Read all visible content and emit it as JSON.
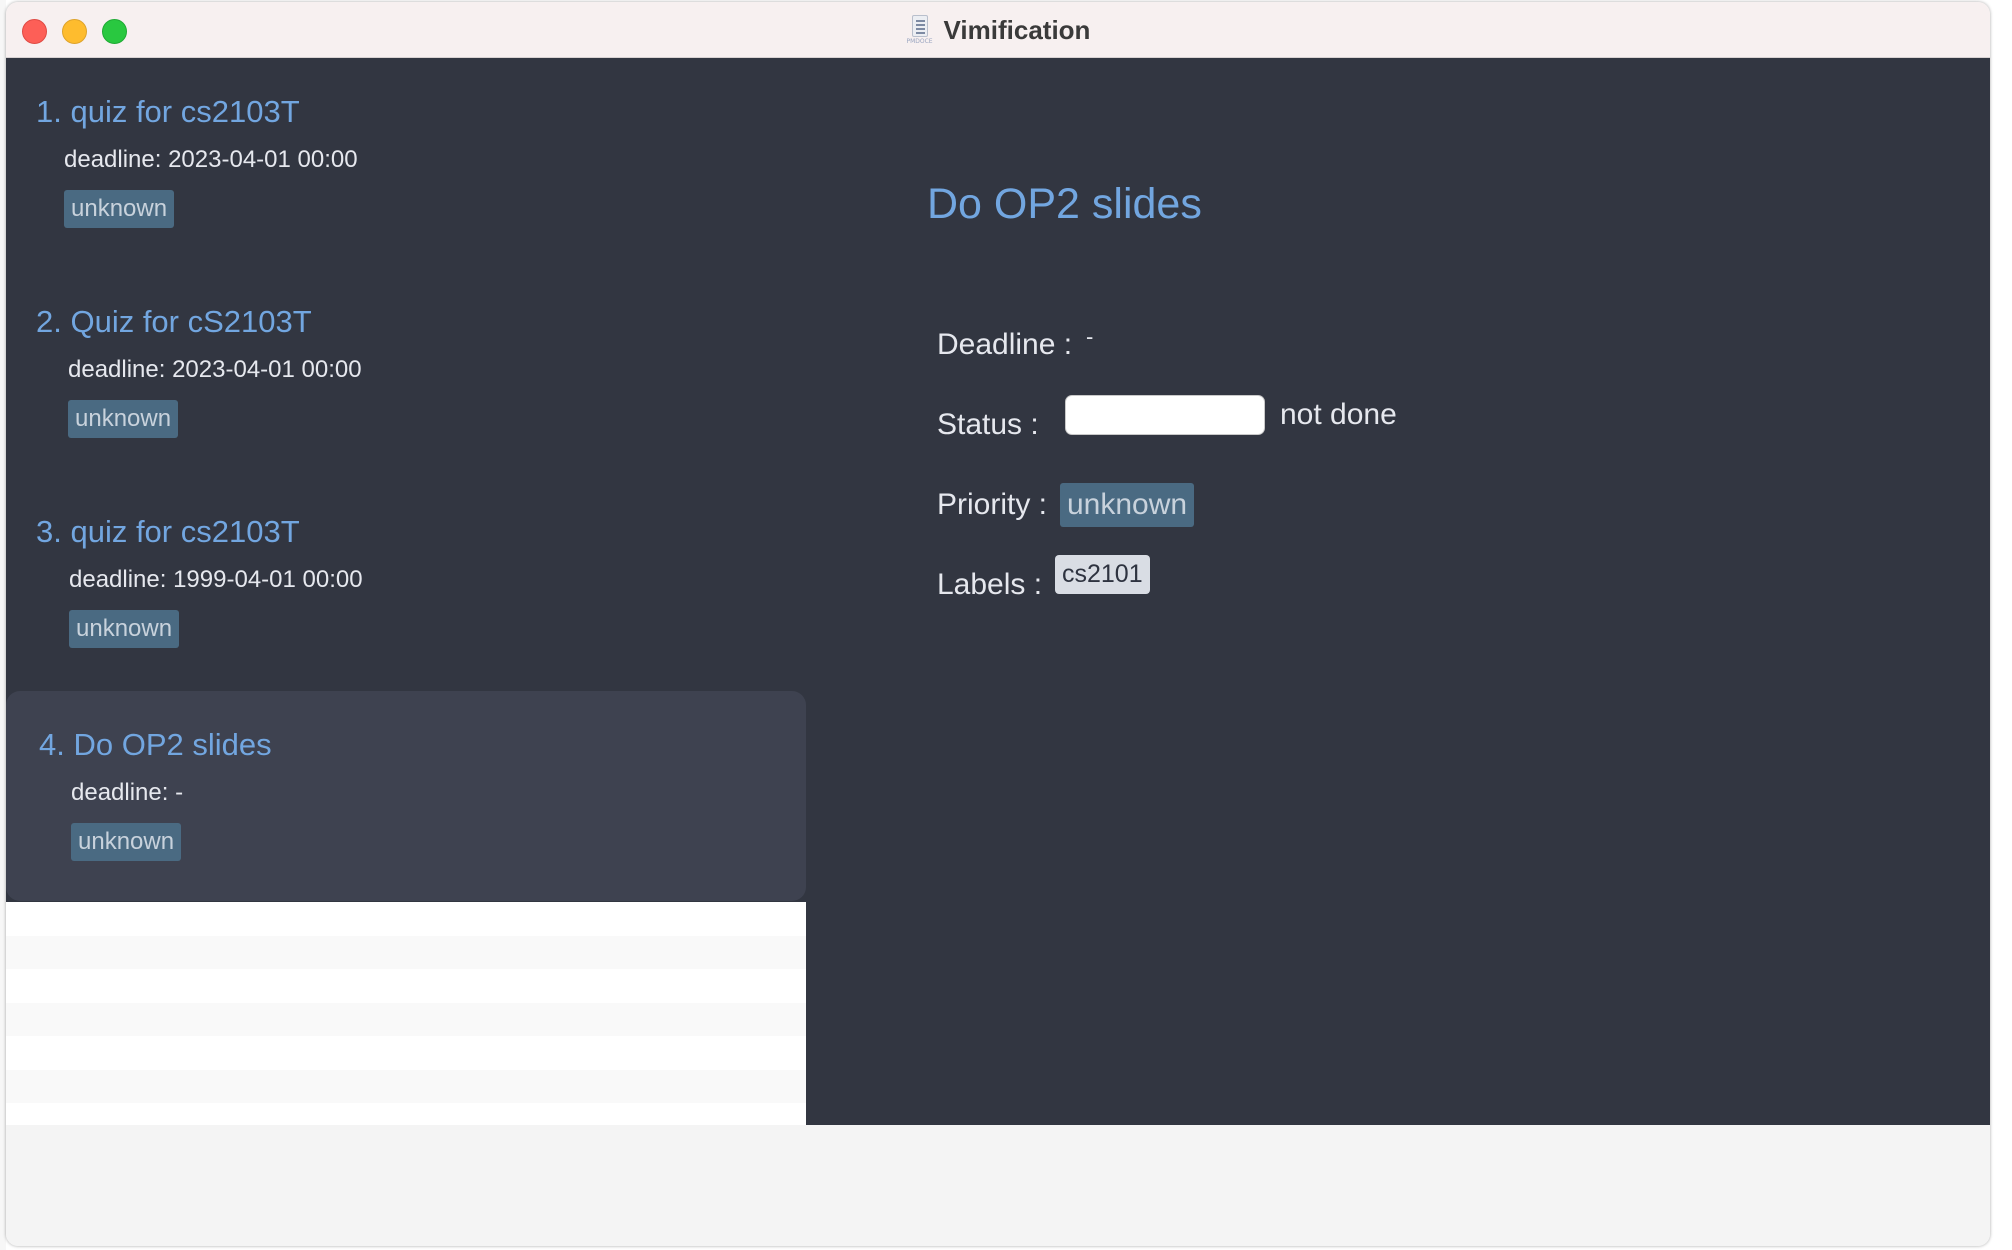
{
  "window": {
    "title": "Vimification",
    "icon": "document-icon",
    "icon_caption": "PMDOCE"
  },
  "task_list": [
    {
      "title": "1. quiz for cs2103T",
      "deadline": "deadline: 2023-04-01 00:00",
      "priority": "unknown",
      "selected": false
    },
    {
      "title": "2. Quiz for cS2103T",
      "deadline": "deadline: 2023-04-01 00:00",
      "priority": "unknown",
      "selected": false
    },
    {
      "title": "3. quiz for cs2103T",
      "deadline": "deadline: 1999-04-01 00:00",
      "priority": "unknown",
      "selected": false
    },
    {
      "title": "4. Do OP2 slides",
      "deadline": "deadline: -",
      "priority": "unknown",
      "selected": true
    }
  ],
  "detail": {
    "title": "Do OP2 slides",
    "deadline_label": "Deadline :",
    "deadline_value": "-",
    "status_label": "Status :",
    "status_value": "not done",
    "priority_label": "Priority :",
    "priority_value": "unknown",
    "labels_label": "Labels :",
    "labels": [
      "cs2101"
    ]
  },
  "colors": {
    "panel_bg": "#323641",
    "selected_bg": "#3e4250",
    "title_blue": "#72a6e0",
    "badge_bg": "#4a6a82",
    "label_chip_bg": "#d9dde4"
  }
}
